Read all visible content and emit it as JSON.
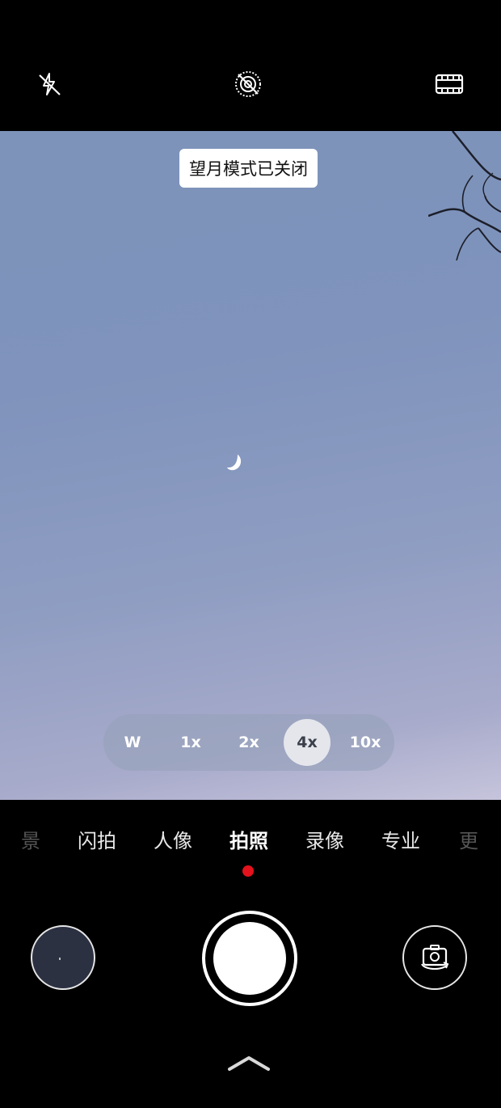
{
  "top_bar": {
    "flash_icon": "flash-off-icon",
    "ai_icon": "ai-lens-off-icon",
    "aspect_icon": "film-frame-icon"
  },
  "viewfinder": {
    "toast": "望月模式已关闭",
    "zoom_options": [
      {
        "label": "W",
        "active": false
      },
      {
        "label": "1x",
        "active": false
      },
      {
        "label": "2x",
        "active": false
      },
      {
        "label": "4x",
        "active": true
      },
      {
        "label": "10x",
        "active": false
      }
    ]
  },
  "modes": [
    "景",
    "闪拍",
    "人像",
    "拍照",
    "录像",
    "专业",
    "更"
  ],
  "active_mode": "拍照",
  "colors": {
    "accent_dot": "#e3121c",
    "sky_top": "#7d93b9",
    "sky_bottom": "#c6c4dc"
  }
}
